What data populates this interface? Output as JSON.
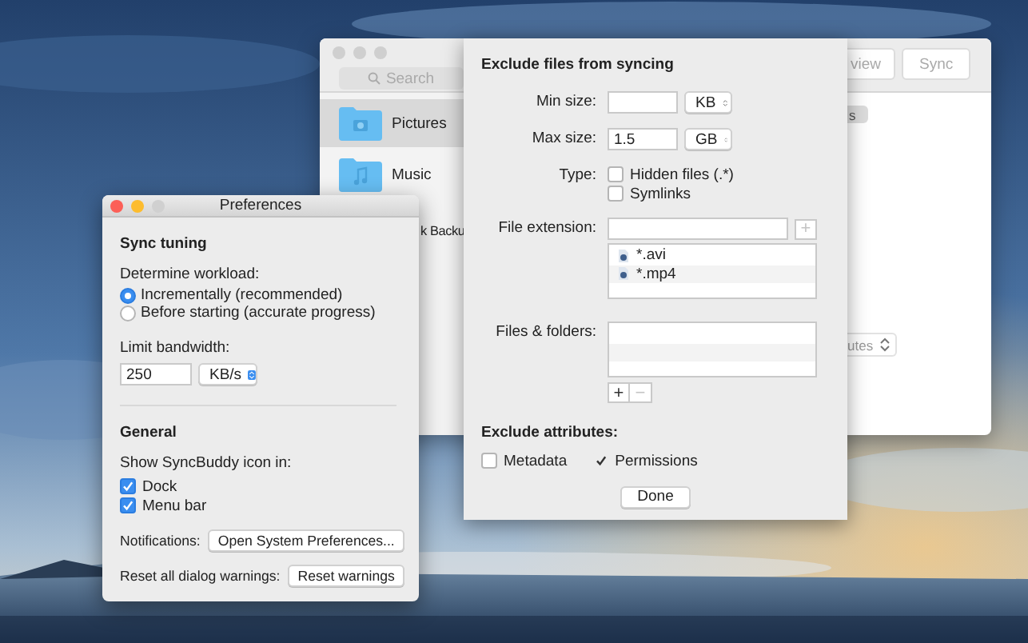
{
  "back_window": {
    "search": {
      "placeholder": "Search"
    },
    "sidebar": {
      "items": [
        {
          "label": "Pictures",
          "selected": true,
          "kind": "pictures"
        },
        {
          "label": "Music",
          "selected": false,
          "kind": "music"
        },
        {
          "label": "k Backu",
          "selected": false,
          "kind": "hidden"
        }
      ]
    },
    "toolbar": {
      "buttons": [
        "view",
        "Sync"
      ]
    },
    "content": {
      "badge": "s",
      "popup": "utes"
    }
  },
  "exclude_sheet": {
    "title": "Exclude files from syncing",
    "min_size": {
      "label": "Min size:",
      "unit": "KB"
    },
    "max_size": {
      "label": "Max size:",
      "value": "1.5",
      "unit": "GB"
    },
    "type": {
      "label": "Type:",
      "options": [
        {
          "label": "Hidden files (.*)",
          "checked": false
        },
        {
          "label": "Symlinks",
          "checked": false
        }
      ]
    },
    "file_extension": {
      "label": "File extension:",
      "add_button": {
        "label": "+",
        "disabled": true
      },
      "items": [
        "*.avi",
        "*.mp4"
      ]
    },
    "files_folders": {
      "label": "Files & folders:",
      "add_button": {
        "label": "+",
        "disabled": false
      },
      "remove_button": {
        "label": "−",
        "disabled": true
      }
    },
    "attributes": {
      "title": "Exclude attributes:",
      "options": [
        {
          "label": "Metadata",
          "checked": false
        },
        {
          "label": "Permissions",
          "checked": true
        }
      ]
    },
    "done_button": "Done"
  },
  "preferences": {
    "title": "Preferences",
    "sync_tuning": {
      "heading": "Sync tuning",
      "workload": {
        "label": "Determine workload:",
        "options": [
          {
            "label": "Incrementally (recommended)",
            "selected": true
          },
          {
            "label": "Before starting (accurate progress)",
            "selected": false
          }
        ]
      },
      "bandwidth": {
        "label": "Limit bandwidth:",
        "value": "250",
        "unit": "KB/s"
      }
    },
    "general": {
      "heading": "General",
      "icon_label": "Show SyncBuddy icon in:",
      "options": [
        {
          "label": "Dock",
          "checked": true
        },
        {
          "label": "Menu bar",
          "checked": true
        }
      ],
      "notifications": {
        "label": "Notifications:",
        "button": "Open System Preferences..."
      },
      "reset": {
        "label": "Reset all dialog warnings:",
        "button": "Reset warnings"
      }
    }
  }
}
